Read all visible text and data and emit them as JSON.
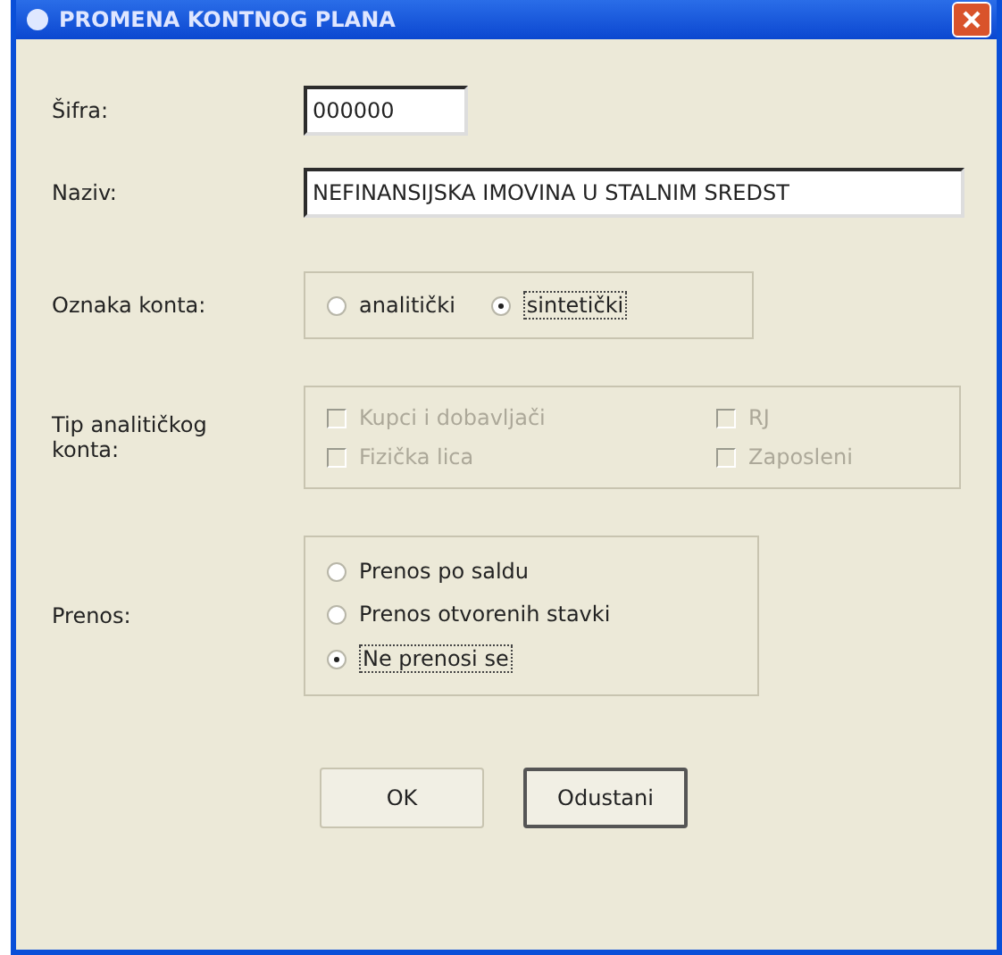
{
  "window": {
    "title": "PROMENA KONTNOG PLANA"
  },
  "fields": [
    {
      "label": "Šifra:",
      "value": "000000",
      "kind": "short"
    },
    {
      "label": "Naziv:",
      "value": "NEFINANSIJSKA IMOVINA U STALNIM SREDST",
      "kind": "long"
    }
  ],
  "account_type": {
    "label": "Oznaka konta:",
    "options": [
      {
        "label": "analitički",
        "selected": false
      },
      {
        "label": "sintetički",
        "selected": true
      }
    ]
  },
  "analytic_type": {
    "label": "Tip analitičkog konta:",
    "disabled": true,
    "options": [
      {
        "label": "Kupci i dobavljači",
        "checked": false
      },
      {
        "label": "RJ",
        "checked": false
      },
      {
        "label": "Fizička lica",
        "checked": false
      },
      {
        "label": "Zaposleni",
        "checked": false
      }
    ]
  },
  "transfer": {
    "label": "Prenos:",
    "options": [
      {
        "label": "Prenos po saldu",
        "selected": false
      },
      {
        "label": "Prenos otvorenih stavki",
        "selected": false
      },
      {
        "label": "Ne prenosi se",
        "selected": true
      }
    ]
  },
  "buttons": [
    {
      "label": "OK",
      "focused": false
    },
    {
      "label": "Odustani",
      "focused": true
    }
  ]
}
